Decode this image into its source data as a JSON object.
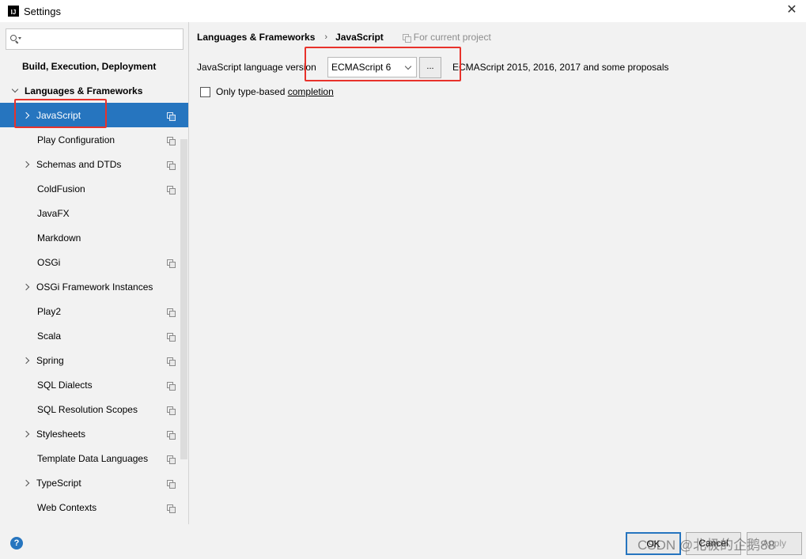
{
  "window": {
    "title": "Settings",
    "app_icon_text": "IJ"
  },
  "search": {
    "placeholder": "",
    "value": ""
  },
  "sidebar": {
    "items": [
      {
        "label": "Build, Execution, Deployment",
        "bold": true,
        "chevron": "none",
        "project_icon": false
      },
      {
        "label": "Languages & Frameworks",
        "bold": true,
        "chevron": "down",
        "project_icon": false
      },
      {
        "label": "JavaScript",
        "bold": false,
        "chevron": "right",
        "project_icon": true,
        "selected": true
      },
      {
        "label": "Play Configuration",
        "bold": false,
        "chevron": "none",
        "project_icon": true
      },
      {
        "label": "Schemas and DTDs",
        "bold": false,
        "chevron": "right",
        "project_icon": true
      },
      {
        "label": "ColdFusion",
        "bold": false,
        "chevron": "none",
        "project_icon": true
      },
      {
        "label": "JavaFX",
        "bold": false,
        "chevron": "none",
        "project_icon": false
      },
      {
        "label": "Markdown",
        "bold": false,
        "chevron": "none",
        "project_icon": false
      },
      {
        "label": "OSGi",
        "bold": false,
        "chevron": "none",
        "project_icon": true
      },
      {
        "label": "OSGi Framework Instances",
        "bold": false,
        "chevron": "right",
        "project_icon": false
      },
      {
        "label": "Play2",
        "bold": false,
        "chevron": "none",
        "project_icon": true
      },
      {
        "label": "Scala",
        "bold": false,
        "chevron": "none",
        "project_icon": true
      },
      {
        "label": "Spring",
        "bold": false,
        "chevron": "right",
        "project_icon": true
      },
      {
        "label": "SQL Dialects",
        "bold": false,
        "chevron": "none",
        "project_icon": true
      },
      {
        "label": "SQL Resolution Scopes",
        "bold": false,
        "chevron": "none",
        "project_icon": true
      },
      {
        "label": "Stylesheets",
        "bold": false,
        "chevron": "right",
        "project_icon": true
      },
      {
        "label": "Template Data Languages",
        "bold": false,
        "chevron": "none",
        "project_icon": true
      },
      {
        "label": "TypeScript",
        "bold": false,
        "chevron": "right",
        "project_icon": true
      },
      {
        "label": "Web Contexts",
        "bold": false,
        "chevron": "none",
        "project_icon": true
      }
    ]
  },
  "breadcrumb": {
    "parent": "Languages & Frameworks",
    "separator": "›",
    "current": "JavaScript",
    "scope": "For current project"
  },
  "settings": {
    "version_label": "JavaScript language version",
    "version_value": "ECMAScript 6",
    "more_button": "...",
    "version_description": "ECMAScript 2015, 2016, 2017 and some proposals",
    "checkbox_label_pre": "Only type-based ",
    "checkbox_label_mnemonic": "completion",
    "checkbox_checked": false
  },
  "buttons": {
    "ok": "OK",
    "cancel": "Cancel",
    "apply": "Apply",
    "help": "?"
  },
  "watermark": "CSDN @北极的企鹅88",
  "colors": {
    "selection": "#2675bf",
    "highlight_box": "#e8322b",
    "background": "#f2f2f2"
  }
}
